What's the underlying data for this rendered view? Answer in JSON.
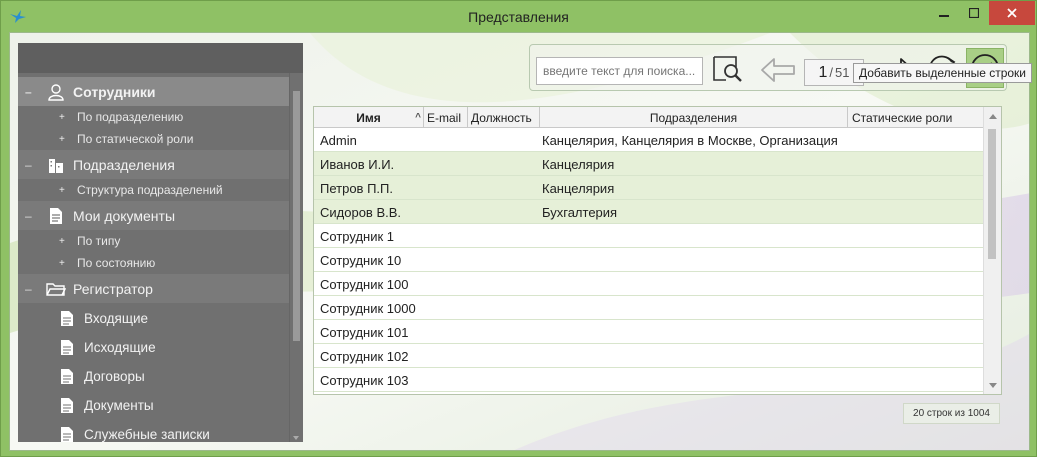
{
  "window": {
    "title": "Представления"
  },
  "colors": {
    "frame": "#8fc165",
    "sidebar": "#707070",
    "selected_row": "#e6f0d8",
    "close_button": "#c7483d"
  },
  "sidebar": {
    "sections": [
      {
        "label": "Сотрудники",
        "icon": "user-icon",
        "items": [
          "По подразделению",
          "По статической роли"
        ]
      },
      {
        "label": "Подразделения",
        "icon": "building-icon",
        "items": [
          "Структура подразделений"
        ]
      },
      {
        "label": "Мои документы",
        "icon": "document-icon",
        "items": [
          "По типу",
          "По состоянию"
        ]
      },
      {
        "label": "Регистратор",
        "icon": "folder-icon",
        "items": [
          "Входящие",
          "Исходящие",
          "Договоры",
          "Документы",
          "Служебные записки"
        ]
      }
    ]
  },
  "toolbar": {
    "search_placeholder": "введите текст для поиска...",
    "page_current": "1",
    "page_total": "51",
    "tooltip": "Добавить выделенные строки"
  },
  "grid": {
    "columns": [
      "Имя",
      "E-mail",
      "Должность",
      "Подразделения",
      "Статические роли"
    ],
    "rows": [
      {
        "name": "Admin",
        "dept": "Канцелярия, Канцелярия в Москве, Организация"
      },
      {
        "name": "Иванов И.И.",
        "dept": "Канцелярия"
      },
      {
        "name": "Петров П.П.",
        "dept": "Канцелярия"
      },
      {
        "name": "Сидоров В.В.",
        "dept": "Бухгалтерия"
      },
      {
        "name": "Сотрудник 1",
        "dept": ""
      },
      {
        "name": "Сотрудник 10",
        "dept": ""
      },
      {
        "name": "Сотрудник 100",
        "dept": ""
      },
      {
        "name": "Сотрудник 1000",
        "dept": ""
      },
      {
        "name": "Сотрудник 101",
        "dept": ""
      },
      {
        "name": "Сотрудник 102",
        "dept": ""
      },
      {
        "name": "Сотрудник 103",
        "dept": ""
      }
    ]
  },
  "status": {
    "row_count": "20 строк из 1004"
  }
}
